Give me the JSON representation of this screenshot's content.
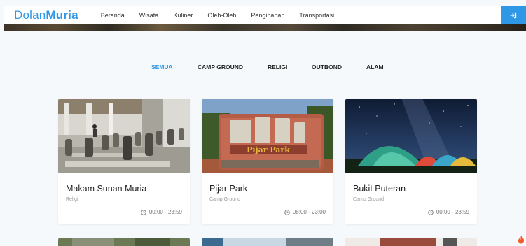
{
  "header": {
    "brand_light": "Dolan",
    "brand_bold": "Muria",
    "nav": [
      "Beranda",
      "Wisata",
      "Kuliner",
      "Oleh-Oleh",
      "Penginapan",
      "Transportasi"
    ],
    "login_icon": "sign-in-icon",
    "accent": "#2e97e6"
  },
  "filters": [
    {
      "label": "SEMUA",
      "active": true
    },
    {
      "label": "CAMP GROUND",
      "active": false
    },
    {
      "label": "RELIGI",
      "active": false
    },
    {
      "label": "OUTBOND",
      "active": false
    },
    {
      "label": "ALAM",
      "active": false
    }
  ],
  "cards": [
    {
      "title": "Makam Sunan Muria",
      "category": "Religi",
      "hours": "00:00 - 23:59"
    },
    {
      "title": "Pijar Park",
      "category": "Camp Ground",
      "hours": "08:00 - 23:00",
      "sign_text": "Pijar Park"
    },
    {
      "title": "Bukit Puteran",
      "category": "Camp Ground",
      "hours": "00:00 - 23:59"
    }
  ]
}
